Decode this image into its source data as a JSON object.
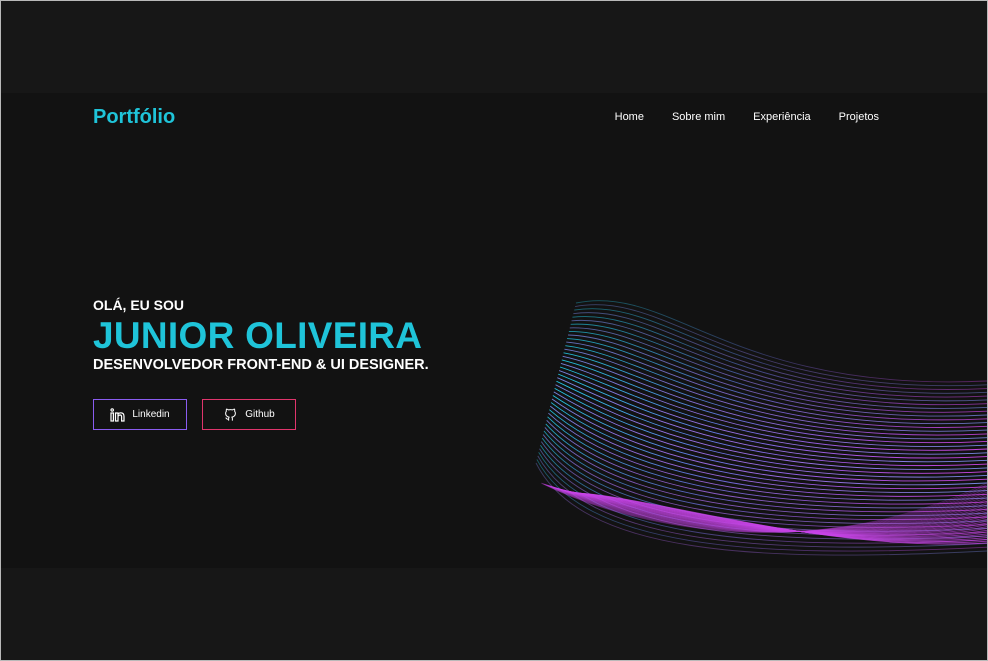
{
  "header": {
    "logo": "Portfólio",
    "nav": [
      "Home",
      "Sobre mim",
      "Experiência",
      "Projetos"
    ]
  },
  "hero": {
    "greeting": "OLÁ, EU SOU",
    "name": "JUNIOR OLIVEIRA",
    "role": "DESENVOLVEDOR FRONT-END & UI DESIGNER.",
    "buttons": {
      "linkedin": "Linkedin",
      "github": "Github"
    }
  },
  "icons": {
    "linkedin": "linkedin-icon",
    "github": "github-icon",
    "wave": "wave-art"
  },
  "colors": {
    "background": "#121212",
    "accent": "#1fc4d9",
    "linkedin_border": "#8a5cf0",
    "github_border": "#e0356c",
    "wave_cyan": "#22d3ee",
    "wave_magenta": "#d946ef"
  }
}
